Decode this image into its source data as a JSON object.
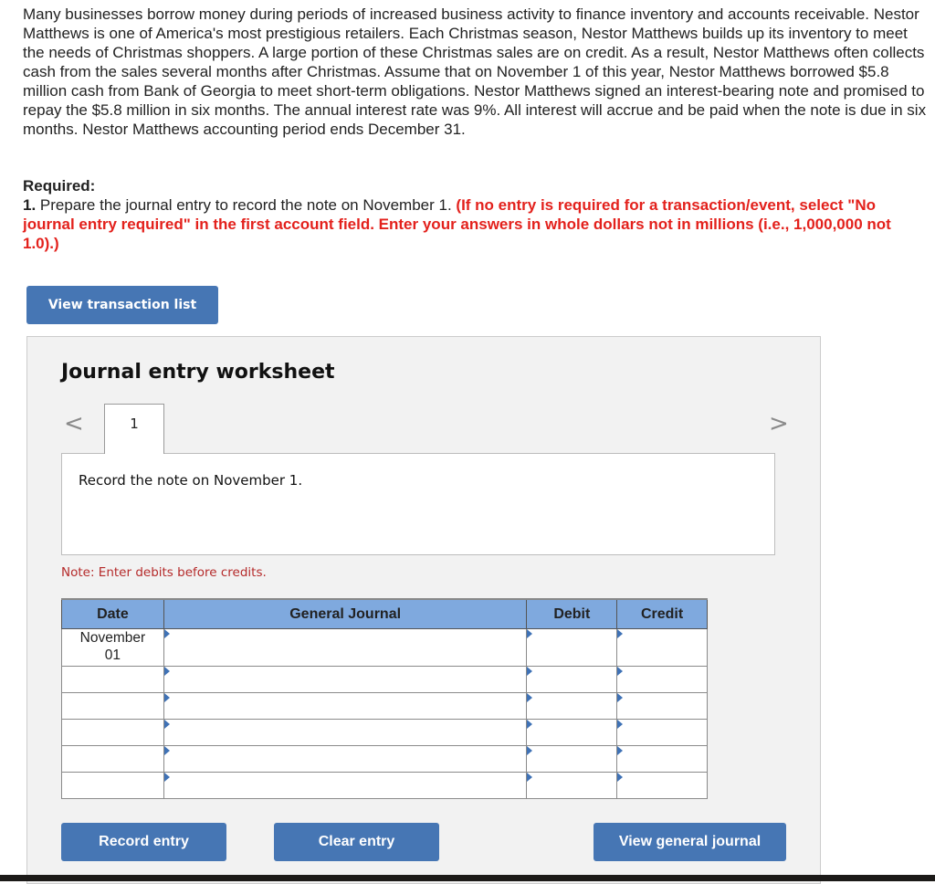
{
  "problem_text": "Many businesses borrow money during periods of increased business activity to finance inventory and accounts receivable. Nestor Matthews is one of America's most prestigious retailers. Each Christmas season, Nestor Matthews builds up its inventory to meet the needs of Christmas shoppers. A large portion of these Christmas sales are on credit. As a result, Nestor Matthews often collects cash from the sales several months after Christmas. Assume that on November 1 of this year, Nestor Matthews borrowed $5.8 million cash from Bank of Georgia to meet short-term obligations. Nestor Matthews signed an interest-bearing note and promised to repay the $5.8 million in six months. The annual interest rate was 9%. All interest will accrue and be paid when the note is due in six months. Nestor Matthews accounting period ends December 31.",
  "required": {
    "title": "Required:",
    "number": "1.",
    "instruction": " Prepare the journal entry to record the note on November 1. ",
    "note_red": "(If no entry is required for a transaction/event, select \"No journal entry required\" in the first account field. Enter your answers in whole dollars not in millions (i.e., 1,000,000 not 1.0).)"
  },
  "buttons": {
    "view_transaction_list": "View transaction list",
    "record_entry": "Record entry",
    "clear_entry": "Clear entry",
    "view_general_journal": "View general journal"
  },
  "worksheet": {
    "title": "Journal entry worksheet",
    "nav_prev_icon": "<",
    "nav_next_icon": ">",
    "tabs": [
      {
        "label": "1"
      }
    ],
    "description": "Record the note on November 1.",
    "note": "Note: Enter debits before credits."
  },
  "journal": {
    "headers": {
      "date": "Date",
      "general_journal": "General Journal",
      "debit": "Debit",
      "credit": "Credit"
    },
    "rows": [
      {
        "date": "November\n01",
        "account": "",
        "debit": "",
        "credit": ""
      },
      {
        "date": "",
        "account": "",
        "debit": "",
        "credit": ""
      },
      {
        "date": "",
        "account": "",
        "debit": "",
        "credit": ""
      },
      {
        "date": "",
        "account": "",
        "debit": "",
        "credit": ""
      },
      {
        "date": "",
        "account": "",
        "debit": "",
        "credit": ""
      },
      {
        "date": "",
        "account": "",
        "debit": "",
        "credit": ""
      }
    ]
  },
  "colors": {
    "button_blue": "#4676b4",
    "header_blue": "#7fa9de",
    "instruction_red": "#e3211c",
    "note_red": "#b52a2a"
  }
}
